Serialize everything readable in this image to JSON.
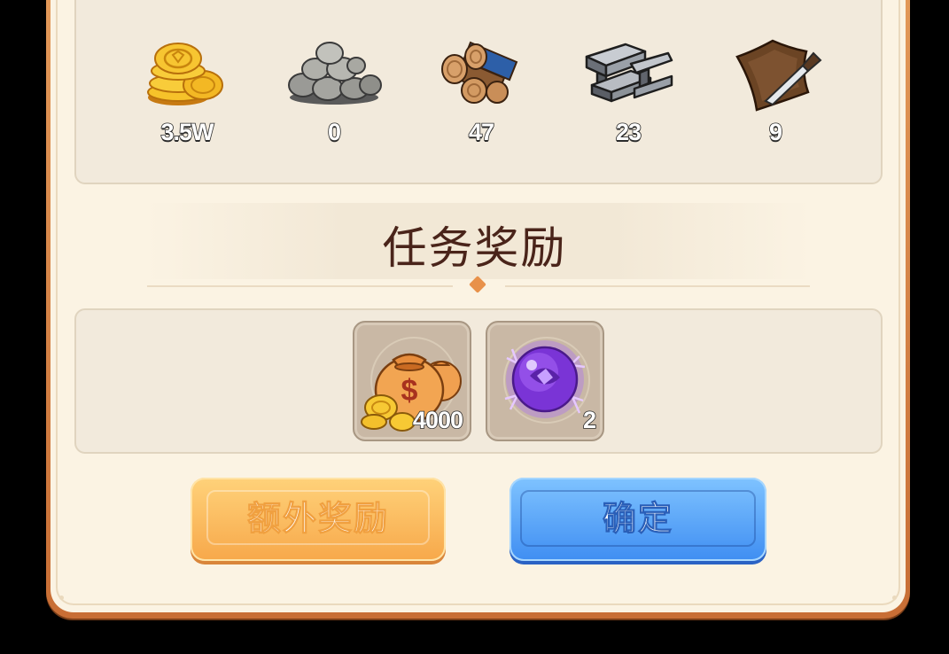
{
  "resources": [
    {
      "name": "gold-coins",
      "count": "3.5W"
    },
    {
      "name": "stone",
      "count": "0"
    },
    {
      "name": "wood",
      "count": "47"
    },
    {
      "name": "iron",
      "count": "23"
    },
    {
      "name": "leather",
      "count": "9"
    }
  ],
  "rewards_section": {
    "title": "任务奖励",
    "items": [
      {
        "icon": "money-bag-icon",
        "quantity": "4000"
      },
      {
        "icon": "purple-orb-icon",
        "quantity": "2"
      }
    ]
  },
  "buttons": {
    "bonus_label": "额外奖励",
    "confirm_label": "确定"
  },
  "colors": {
    "panel_bg": "#fbf3e3",
    "panel_border": "#d98a4a",
    "title_text": "#4a241a",
    "bonus_button": "#f7a84a",
    "confirm_button": "#3f8ef2"
  }
}
